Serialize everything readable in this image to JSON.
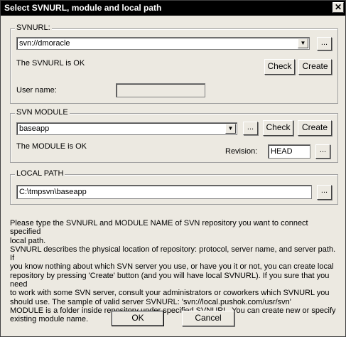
{
  "window": {
    "title": "Select SVNURL, module and local path",
    "close_glyph": "✕"
  },
  "svnurl": {
    "legend": "SVNURL:",
    "value": "svn://dmoracle",
    "browse_label": "...",
    "status": "The SVNURL is OK",
    "check_label": "Check",
    "create_label": "Create",
    "username_label": "User name:",
    "username_value": ""
  },
  "module": {
    "legend": "SVN MODULE",
    "value": "baseapp",
    "browse_label": "...",
    "check_label": "Check",
    "create_label": "Create",
    "status": "The MODULE is OK",
    "revision_label": "Revision:",
    "revision_value": "HEAD",
    "revision_browse_label": "..."
  },
  "local_path": {
    "legend": "LOCAL PATH",
    "value": "C:\\tmpsvn\\baseapp",
    "browse_label": "..."
  },
  "description": [
    "Please type the SVNURL and MODULE NAME of SVN repository you want to connect specified",
    "local path.",
    "SVNURL describes the physical location of repository: protocol, server name, and server path.  If",
    "you know nothing about which SVN server you use, or have you it or not, you can create local",
    "repository by pressing 'Create' button (and you will have local SVNURL). If you sure that you need",
    "to work with some SVN server, consult your administrators or coworkers which SVNURL you",
    "should use. The sample of valid server SVNURL: 'svn://local.pushok.com/usr/svn'",
    "MODULE is a folder inside repository under specified SVNURL. You can create new or specify",
    "existing module name."
  ],
  "buttons": {
    "ok": "OK",
    "cancel": "Cancel"
  }
}
